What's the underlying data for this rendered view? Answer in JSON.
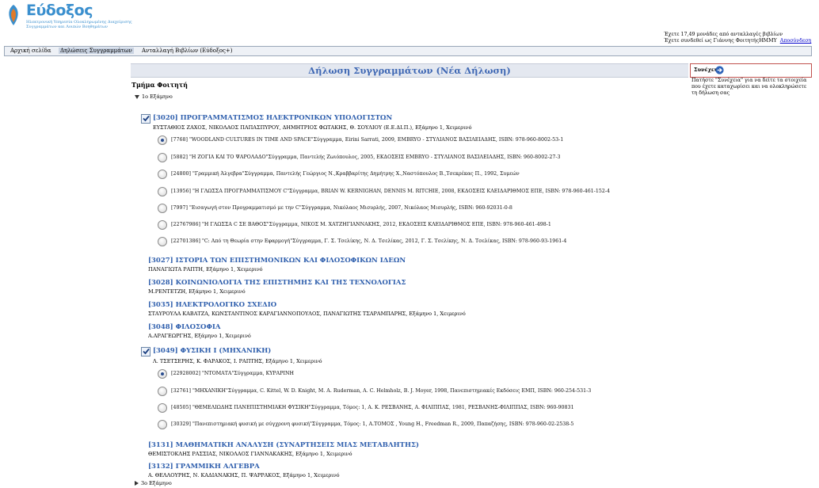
{
  "header": {
    "logo_text": "Εύδοξος",
    "logo_tagline_1": "Ηλεκτρονική Υπηρεσία Ολοκληρωμένης Διαχείρισης",
    "logo_tagline_2": "Συγγραμμάτων και Λοιπών Βοηθημάτων",
    "user_line_1": "Έχετε 17,49 μονάδες από ανταλλαγές βιβλίων",
    "user_line_2": "Έχετε συνδεθεί ως Γιάννης ΦοιτητήςΗΜΜΥ",
    "logout_label": "Αποσύνδεση"
  },
  "nav": {
    "items": [
      {
        "label": "Αρχική σελίδα"
      },
      {
        "label": "Δηλώσεις Συγγραμμάτων"
      },
      {
        "label": "Ανταλλαγή Βιβλίων (Εύδοξος+)"
      }
    ]
  },
  "main": {
    "title": "Δήλωση Συγγραμμάτων (Νέα Δήλωση)",
    "section_heading": "Τμήμα Φοιτητή",
    "semester_1_label": "1ο Εξάμηνο",
    "semester_3_label": "3ο Εξάμηνο"
  },
  "side": {
    "continue_label": "Συνέχεια",
    "hint": "Πατήστε \"Συνέχεια\" για να δείτε τα στοιχεία που έχετε καταχωρίσει και να ολοκληρώσετε τη δήλωση σας"
  },
  "courses": [
    {
      "title": "[3020] ΠΡΟΓΡΑΜΜΑΤΙΣΜΟΣ ΗΛΕΚΤΡΟΝΙΚΩΝ ΥΠΟΛΟΓΙΣΤΩΝ",
      "info": "ΕΥΣΤΑΘΙΟΣ ΖΑΧΟΣ, ΝΙΚΟΛΑΟΣ ΠΑΠΑΣΠΥΡΟΥ, ΔΗΜΗΤΡΙΟΣ ΦΩΤΑΚΗΣ, Θ. ΣΟΥΛΙΟΥ (Ε.Ε.ΔΙ.Π.), Εξάμηνο 1, Χειμερινό",
      "checked": true,
      "options": [
        {
          "text": "[7768] \"WOODLAND CULTURES IN TIME AND SPACE\"Σύγγραμμα, Eirini Sarrati, 2009, EMBRYO - ΣΤΥΛΙΑΝΟΣ ΒΑΣΙΛΕΙΑΔΗΣ, ISBN: 978-960-8002-53-1",
          "selected": true
        },
        {
          "text": "[5882] \"Η ΖΟΓΙΑ ΚΑΙ ΤΟ ΨΑΡΟΛΑΔΟ\"Σύγγραμμα, Παντελής Ζωιόπουλος, 2005, ΕΚΔΟΣΕΙΣ EMBRYO - ΣΤΥΛΙΑΝΟΣ ΒΑΣΙΛΕΙΑΔΗΣ, ISBN: 960-8002-27-3",
          "selected": false
        },
        {
          "text": "[24800] \"Γραμμική Άλγεβρα\"Σύγγραμμα, Παντελής Γεώργιος Ν.,Κραββαρίτης Δημήτρης Χ.,Ναστόπουλος Β.,Τσεκρέκας Π., 1992, Συμεών",
          "selected": false
        },
        {
          "text": "[13956] \"Η ΓΛΩΣΣΑ ΠΡΟΓΡΑΜΜΑΤΙΣΜΟΥ C\"Σύγγραμμα, BRIAN W. KERNIGHAN, DENNIS M. RITCHIE, 2008, ΕΚΔΟΣΕΙΣ ΚΛΕΙΔΑΡΙΘΜΟΣ ΕΠΕ, ISBN: 978-960-461-152-4",
          "selected": false
        },
        {
          "text": "[7997] \"Εισαγωγή στον Προγραμματισμό με την C\"Σύγγραμμα, Νικόλαος Μισυρλής, 2007, Νικόλαος Μισυρλής, ISBN: 960-92031-0-8",
          "selected": false
        },
        {
          "text": "[22767986] \"Η ΓΛΩΣΣΑ C ΣΕ ΒΑΘΟΣ\"Σύγγραμμα, ΝΙΚΟΣ Μ. ΧΑΤΖΗΓΙΑΝΝΑΚΗΣ, 2012, ΕΚΔΟΣΕΙΣ ΚΛΕΙΔΑΡΙΘΜΟΣ ΕΠΕ, ISBN: 978-960-461-498-1",
          "selected": false
        },
        {
          "text": "[22701386] \"C: Από τη Θεωρία στην Εφαρμογή\"Σύγγραμμα, Γ. Σ. Τσελίκης, Ν. Δ. Τσελίκας, 2012, Γ. Σ. Τσελίκης, Ν. Δ. Τσελίκας, ISBN: 978-960-93-1961-4",
          "selected": false
        }
      ]
    },
    {
      "title": "[3027] ΙΣΤΟΡΙΑ ΤΩΝ ΕΠΙΣΤΗΜΟΝΙΚΩΝ ΚΑΙ ΦΙΛΟΣΟΦΙΚΩΝ ΙΔΕΩΝ",
      "info": "ΠΑΝΑΓΙΩΤΑ ΡΑΠΤΗ, Εξάμηνο 1, Χειμερινό",
      "checked": false,
      "options": []
    },
    {
      "title": "[3028] ΚΟΙΝΩΝΙΟΛΟΓΙΑ ΤΗΣ ΕΠΙΣΤΗΜΗΣ ΚΑΙ ΤΗΣ ΤΕΧΝΟΛΟΓΙΑΣ",
      "info": "Μ.ΡΕΝΤΕΤΖΗ, Εξάμηνο 1, Χειμερινό",
      "checked": false,
      "options": []
    },
    {
      "title": "[3035] ΗΛΕΚΤΡΟΛΟΓΙΚΟ ΣΧΕΔΙΟ",
      "info": "ΣΤΑΥΡΟΥΛΑ ΚΑΒΑΤΖΑ, ΚΩΝΣΤΑΝΤΙΝΟΣ ΚΑΡΑΓΙΑΝΝΟΠΟΥΛΟΣ, ΠΑΝΑΓΙΩΤΗΣ ΤΣΑΡΑΜΠΑΡΗΣ, Εξάμηνο 1, Χειμερινό",
      "checked": false,
      "options": []
    },
    {
      "title": "[3048] ΦΙΛΟΣΟΦΙΑ",
      "info": "Α.ΑΡΑΓΕΩΡΓΗΣ, Εξάμηνο 1, Χειμερινό",
      "checked": false,
      "options": []
    },
    {
      "title": "[3049] ΦΥΣΙΚΗ Ι (ΜΗΧΑΝΙΚΗ)",
      "info": "Λ. ΤΣΕΤΣΕΡΗΣ, Κ. ΦΑΡΑΚΟΣ, Ι. ΡΑΠΤΗΣ, Εξάμηνο 1, Χειμερινό",
      "checked": true,
      "options": [
        {
          "text": "[22928002] \"ΝΤΟΜΑΤΑ\"Σύγγραμμα, ΚΥΡΑΡΙΝΗ",
          "selected": true
        },
        {
          "text": "[32761] \"ΜΗΧΑΝΙΚΗ\"Σύγγραμμα, C. Kittel, W. D. Knight, M. A. Ruderman, A. C. Helmholz, B. J. Moyer, 1998, Πανεπιστημιακές Εκδόσεις ΕΜΠ, ISBN: 960-254-531-3",
          "selected": false
        },
        {
          "text": "[48505] \"ΘΕΜΕΛΙΩΔΗΣ ΠΑΝΕΠΙΣΤΗΜΙΑΚΗ ΦΥΣΙΚΗ\"Σύγγραμμα, Τόμος: 1, Α. Κ. ΡΕΣΒΑΝΗΣ, Α. ΦΙΛΙΠΠΑΣ, 1981, ΡΕΣΒΑΝΗΣ-ΦΙΛΙΠΠΑΣ, ISBN: 960-90831",
          "selected": false
        },
        {
          "text": "[30329] \"Πανεπιστημιακή φυσική με σύγχρονη φυσική\"Σύγγραμμα, Τόμος: 1, A.TOMOΣ , Young H., Freedman R., 2009, Παπαζήσης, ISBN: 978-960-02-2538-5",
          "selected": false
        }
      ]
    },
    {
      "title": "[3131] ΜΑΘΗΜΑΤΙΚΗ ΑΝΑΛΥΣΗ (ΣΥΝΑΡΤΗΣΕΙΣ ΜΙΑΣ ΜΕΤΑΒΛΗΤΗΣ)",
      "info": "ΘΕΜΙΣΤΟΚΛΗΣ ΡΑΣΣΙΑΣ, ΝΙΚΟΛΑΟΣ ΓΙΑΝΝΑΚΑΚΗΣ, Εξάμηνο 1, Χειμερινό",
      "checked": false,
      "options": []
    },
    {
      "title": "[3132] ΓΡΑΜΜΙΚΗ ΑΛΓΕΒΡΑ",
      "info": "Α. ΘΕΛΛΟΥΡΗΣ, Ν. ΚΑΔΙΑΝΑΚΗΣ, Π. ΨΑΡΡΑΚΟΣ, Εξάμηνο 1, Χειμερινό",
      "checked": false,
      "options": []
    }
  ]
}
